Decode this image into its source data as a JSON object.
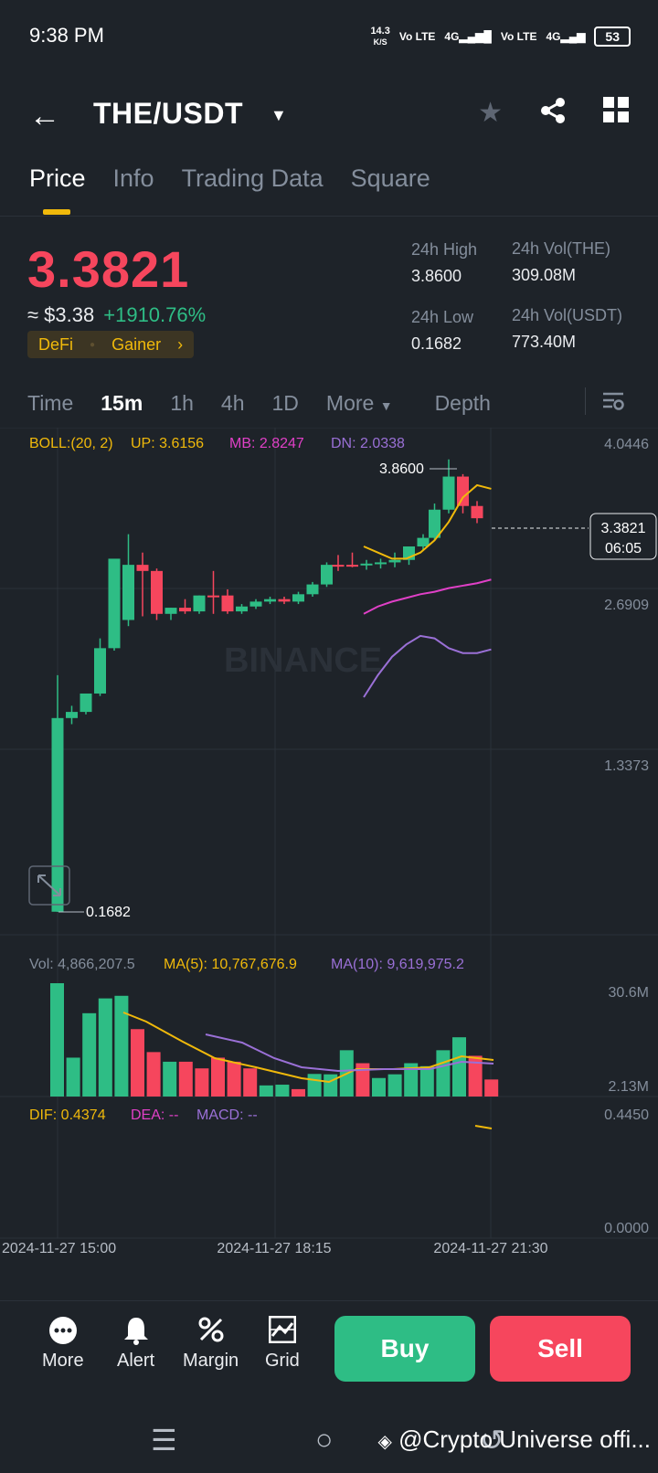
{
  "status": {
    "time": "9:38 PM",
    "speed": "14.3",
    "speed_unit": "K/S",
    "net1": "Vo LTE",
    "net2": "4G",
    "net3": "Vo LTE",
    "net4": "4G",
    "battery": "53"
  },
  "header": {
    "pair": "THE/USDT"
  },
  "tabs": [
    "Price",
    "Info",
    "Trading Data",
    "Square"
  ],
  "ticker": {
    "price": "3.3821",
    "usd": "≈ $3.38",
    "change": "+1910.76%",
    "tag1": "DeFi",
    "tag2": "Gainer",
    "high_label": "24h High",
    "high": "3.8600",
    "low_label": "24h Low",
    "low": "0.1682",
    "vol_the_label": "24h Vol(THE)",
    "vol_the": "309.08M",
    "vol_usdt_label": "24h Vol(USDT)",
    "vol_usdt": "773.40M"
  },
  "intervals": {
    "time": "Time",
    "m15": "15m",
    "h1": "1h",
    "h4": "4h",
    "d1": "1D",
    "more": "More",
    "depth": "Depth"
  },
  "indicators": {
    "boll": "BOLL:(20, 2)",
    "up": "UP: 3.6156",
    "mb": "MB: 2.8247",
    "dn": "DN: 2.0338",
    "vol": "Vol: 4,866,207.5",
    "ma5": "MA(5): 10,767,676.9",
    "ma10": "MA(10): 9,619,975.2",
    "dif": "DIF: 0.4374",
    "dea": "DEA: --",
    "macd": "MACD: --"
  },
  "axis": {
    "price_ticks": [
      "4.0446",
      "2.6909",
      "1.3373"
    ],
    "vol_ticks": [
      "30.6M",
      "2.13M"
    ],
    "macd_ticks": [
      "0.4450",
      "0.0000"
    ],
    "time_ticks": [
      "2024-11-27 15:00",
      "2024-11-27 18:15",
      "2024-11-27 21:30"
    ],
    "last_price": "3.3821",
    "countdown": "06:05",
    "high_marker": "3.8600",
    "low_marker": "0.1682",
    "watermark": "BINANCE"
  },
  "chart_data": {
    "type": "candlestick",
    "ylim": [
      0,
      4.0446
    ],
    "candles": [
      {
        "o": 0.17,
        "h": 2.1,
        "l": 0.1682,
        "c": 1.75,
        "up": true
      },
      {
        "o": 1.75,
        "h": 1.85,
        "l": 1.7,
        "c": 1.8,
        "up": true
      },
      {
        "o": 1.8,
        "h": 1.95,
        "l": 1.78,
        "c": 1.95,
        "up": true
      },
      {
        "o": 1.95,
        "h": 2.4,
        "l": 1.93,
        "c": 2.32,
        "up": true
      },
      {
        "o": 2.32,
        "h": 2.7,
        "l": 2.3,
        "c": 3.05,
        "up": true
      },
      {
        "o": 2.55,
        "h": 3.25,
        "l": 2.5,
        "c": 3.0,
        "up": true
      },
      {
        "o": 3.0,
        "h": 3.1,
        "l": 2.58,
        "c": 2.95,
        "up": false
      },
      {
        "o": 2.95,
        "h": 2.97,
        "l": 2.55,
        "c": 2.6,
        "up": false
      },
      {
        "o": 2.6,
        "h": 2.65,
        "l": 2.55,
        "c": 2.65,
        "up": true
      },
      {
        "o": 2.65,
        "h": 2.72,
        "l": 2.6,
        "c": 2.62,
        "up": false
      },
      {
        "o": 2.62,
        "h": 2.75,
        "l": 2.6,
        "c": 2.75,
        "up": true
      },
      {
        "o": 2.75,
        "h": 2.95,
        "l": 2.6,
        "c": 2.75,
        "up": false
      },
      {
        "o": 2.75,
        "h": 2.8,
        "l": 2.6,
        "c": 2.62,
        "up": false
      },
      {
        "o": 2.62,
        "h": 2.68,
        "l": 2.6,
        "c": 2.66,
        "up": true
      },
      {
        "o": 2.66,
        "h": 2.72,
        "l": 2.64,
        "c": 2.7,
        "up": true
      },
      {
        "o": 2.7,
        "h": 2.74,
        "l": 2.68,
        "c": 2.72,
        "up": true
      },
      {
        "o": 2.72,
        "h": 2.74,
        "l": 2.68,
        "c": 2.7,
        "up": false
      },
      {
        "o": 2.7,
        "h": 2.78,
        "l": 2.68,
        "c": 2.76,
        "up": true
      },
      {
        "o": 2.76,
        "h": 2.86,
        "l": 2.74,
        "c": 2.84,
        "up": true
      },
      {
        "o": 2.84,
        "h": 3.02,
        "l": 2.82,
        "c": 3.0,
        "up": true
      },
      {
        "o": 3.0,
        "h": 3.08,
        "l": 2.95,
        "c": 3.0,
        "up": false
      },
      {
        "o": 3.0,
        "h": 3.1,
        "l": 2.98,
        "c": 3.0,
        "up": false
      },
      {
        "o": 3.0,
        "h": 3.04,
        "l": 2.96,
        "c": 3.01,
        "up": true
      },
      {
        "o": 3.01,
        "h": 3.05,
        "l": 2.97,
        "c": 3.02,
        "up": true
      },
      {
        "o": 3.02,
        "h": 3.1,
        "l": 2.98,
        "c": 3.04,
        "up": true
      },
      {
        "o": 3.04,
        "h": 3.15,
        "l": 3.0,
        "c": 3.15,
        "up": true
      },
      {
        "o": 3.15,
        "h": 3.25,
        "l": 3.12,
        "c": 3.22,
        "up": true
      },
      {
        "o": 3.22,
        "h": 3.5,
        "l": 3.2,
        "c": 3.45,
        "up": true
      },
      {
        "o": 3.45,
        "h": 3.86,
        "l": 3.42,
        "c": 3.72,
        "up": true
      },
      {
        "o": 3.72,
        "h": 3.74,
        "l": 3.42,
        "c": 3.48,
        "up": false
      },
      {
        "o": 3.48,
        "h": 3.52,
        "l": 3.34,
        "c": 3.38,
        "up": false
      }
    ],
    "volumes": [
      {
        "v": 30.6,
        "up": true
      },
      {
        "v": 10.5,
        "up": true
      },
      {
        "v": 22.5,
        "up": true
      },
      {
        "v": 26.5,
        "up": true
      },
      {
        "v": 27.2,
        "up": true
      },
      {
        "v": 18.2,
        "up": false
      },
      {
        "v": 12.0,
        "up": false
      },
      {
        "v": 9.4,
        "up": true
      },
      {
        "v": 9.4,
        "up": false
      },
      {
        "v": 7.6,
        "up": false
      },
      {
        "v": 10.5,
        "up": false
      },
      {
        "v": 9.4,
        "up": false
      },
      {
        "v": 7.6,
        "up": false
      },
      {
        "v": 3.0,
        "up": true
      },
      {
        "v": 3.2,
        "up": true
      },
      {
        "v": 2.0,
        "up": false
      },
      {
        "v": 6.1,
        "up": true
      },
      {
        "v": 6.0,
        "up": true
      },
      {
        "v": 12.5,
        "up": true
      },
      {
        "v": 9.0,
        "up": false
      },
      {
        "v": 5.0,
        "up": true
      },
      {
        "v": 6.0,
        "up": true
      },
      {
        "v": 9.0,
        "up": true
      },
      {
        "v": 8.2,
        "up": true
      },
      {
        "v": 12.5,
        "up": true
      },
      {
        "v": 16.0,
        "up": true
      },
      {
        "v": 11.0,
        "up": false
      },
      {
        "v": 4.6,
        "up": false
      }
    ]
  }
}
